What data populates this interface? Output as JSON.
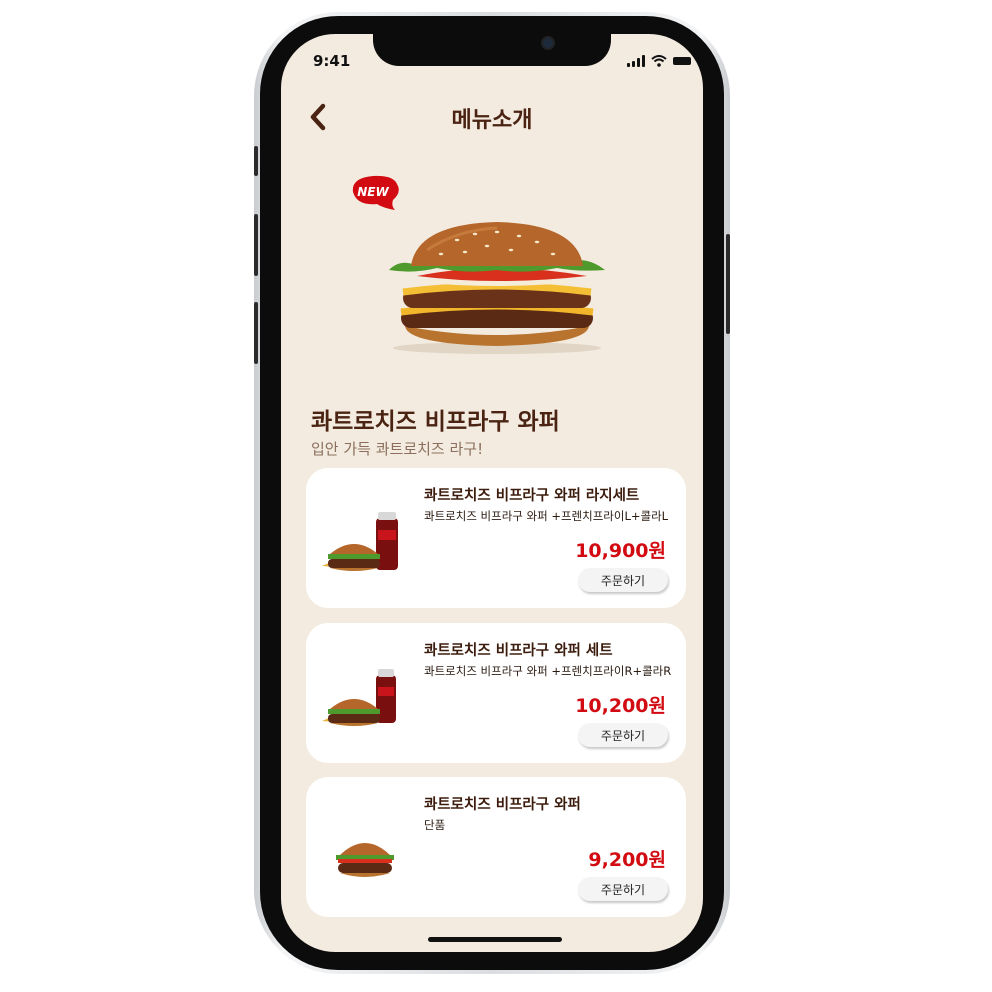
{
  "status_bar": {
    "time": "9:41"
  },
  "header": {
    "title": "메뉴소개"
  },
  "hero": {
    "badge": "NEW"
  },
  "product": {
    "name": "콰트로치즈 비프라구 와퍼",
    "tagline": "입안 가득 콰트로치즈 라구!"
  },
  "menu_items": [
    {
      "name": "콰트로치즈 비프라구 와퍼 라지세트",
      "description": "콰트로치즈 비프라구 와퍼 +프렌치프라이L+콜라L",
      "price": "10,900원",
      "order_label": "주문하기"
    },
    {
      "name": "콰트로치즈 비프라구 와퍼 세트",
      "description": "콰트로치즈 비프라구 와퍼 +프렌치프라이R+콜라R",
      "price": "10,200원",
      "order_label": "주문하기"
    },
    {
      "name": "콰트로치즈 비프라구 와퍼",
      "description": "단품",
      "price": "9,200원",
      "order_label": "주문하기"
    }
  ],
  "colors": {
    "background": "#f3ebe0",
    "brand_brown": "#4a2312",
    "price_red": "#d20a11",
    "card_bg": "#ffffff"
  }
}
